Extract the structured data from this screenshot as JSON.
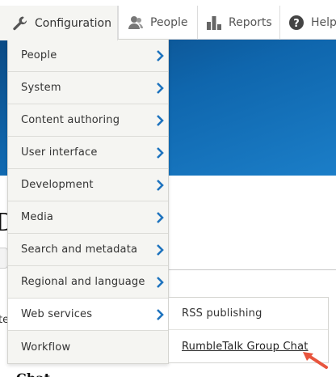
{
  "toolbar": {
    "configuration_label": "Configuration",
    "people_label": "People",
    "reports_label": "Reports",
    "help_label": "Help"
  },
  "background": {
    "heading_fragment": "D",
    "text_fragment": "te",
    "chat_fragment": "Chat"
  },
  "menu": {
    "items": [
      {
        "label": "People"
      },
      {
        "label": "System"
      },
      {
        "label": "Content authoring"
      },
      {
        "label": "User interface"
      },
      {
        "label": "Development"
      },
      {
        "label": "Media"
      },
      {
        "label": "Search and metadata"
      },
      {
        "label": "Regional and language"
      },
      {
        "label": "Web services"
      },
      {
        "label": "Workflow"
      }
    ]
  },
  "submenu": {
    "items": [
      {
        "label": "RSS publishing"
      },
      {
        "label": "RumbleTalk Group Chat"
      }
    ]
  },
  "colors": {
    "chevron": "#1e73be",
    "banner": "#0f66ad",
    "pointer": "#e8553e"
  }
}
